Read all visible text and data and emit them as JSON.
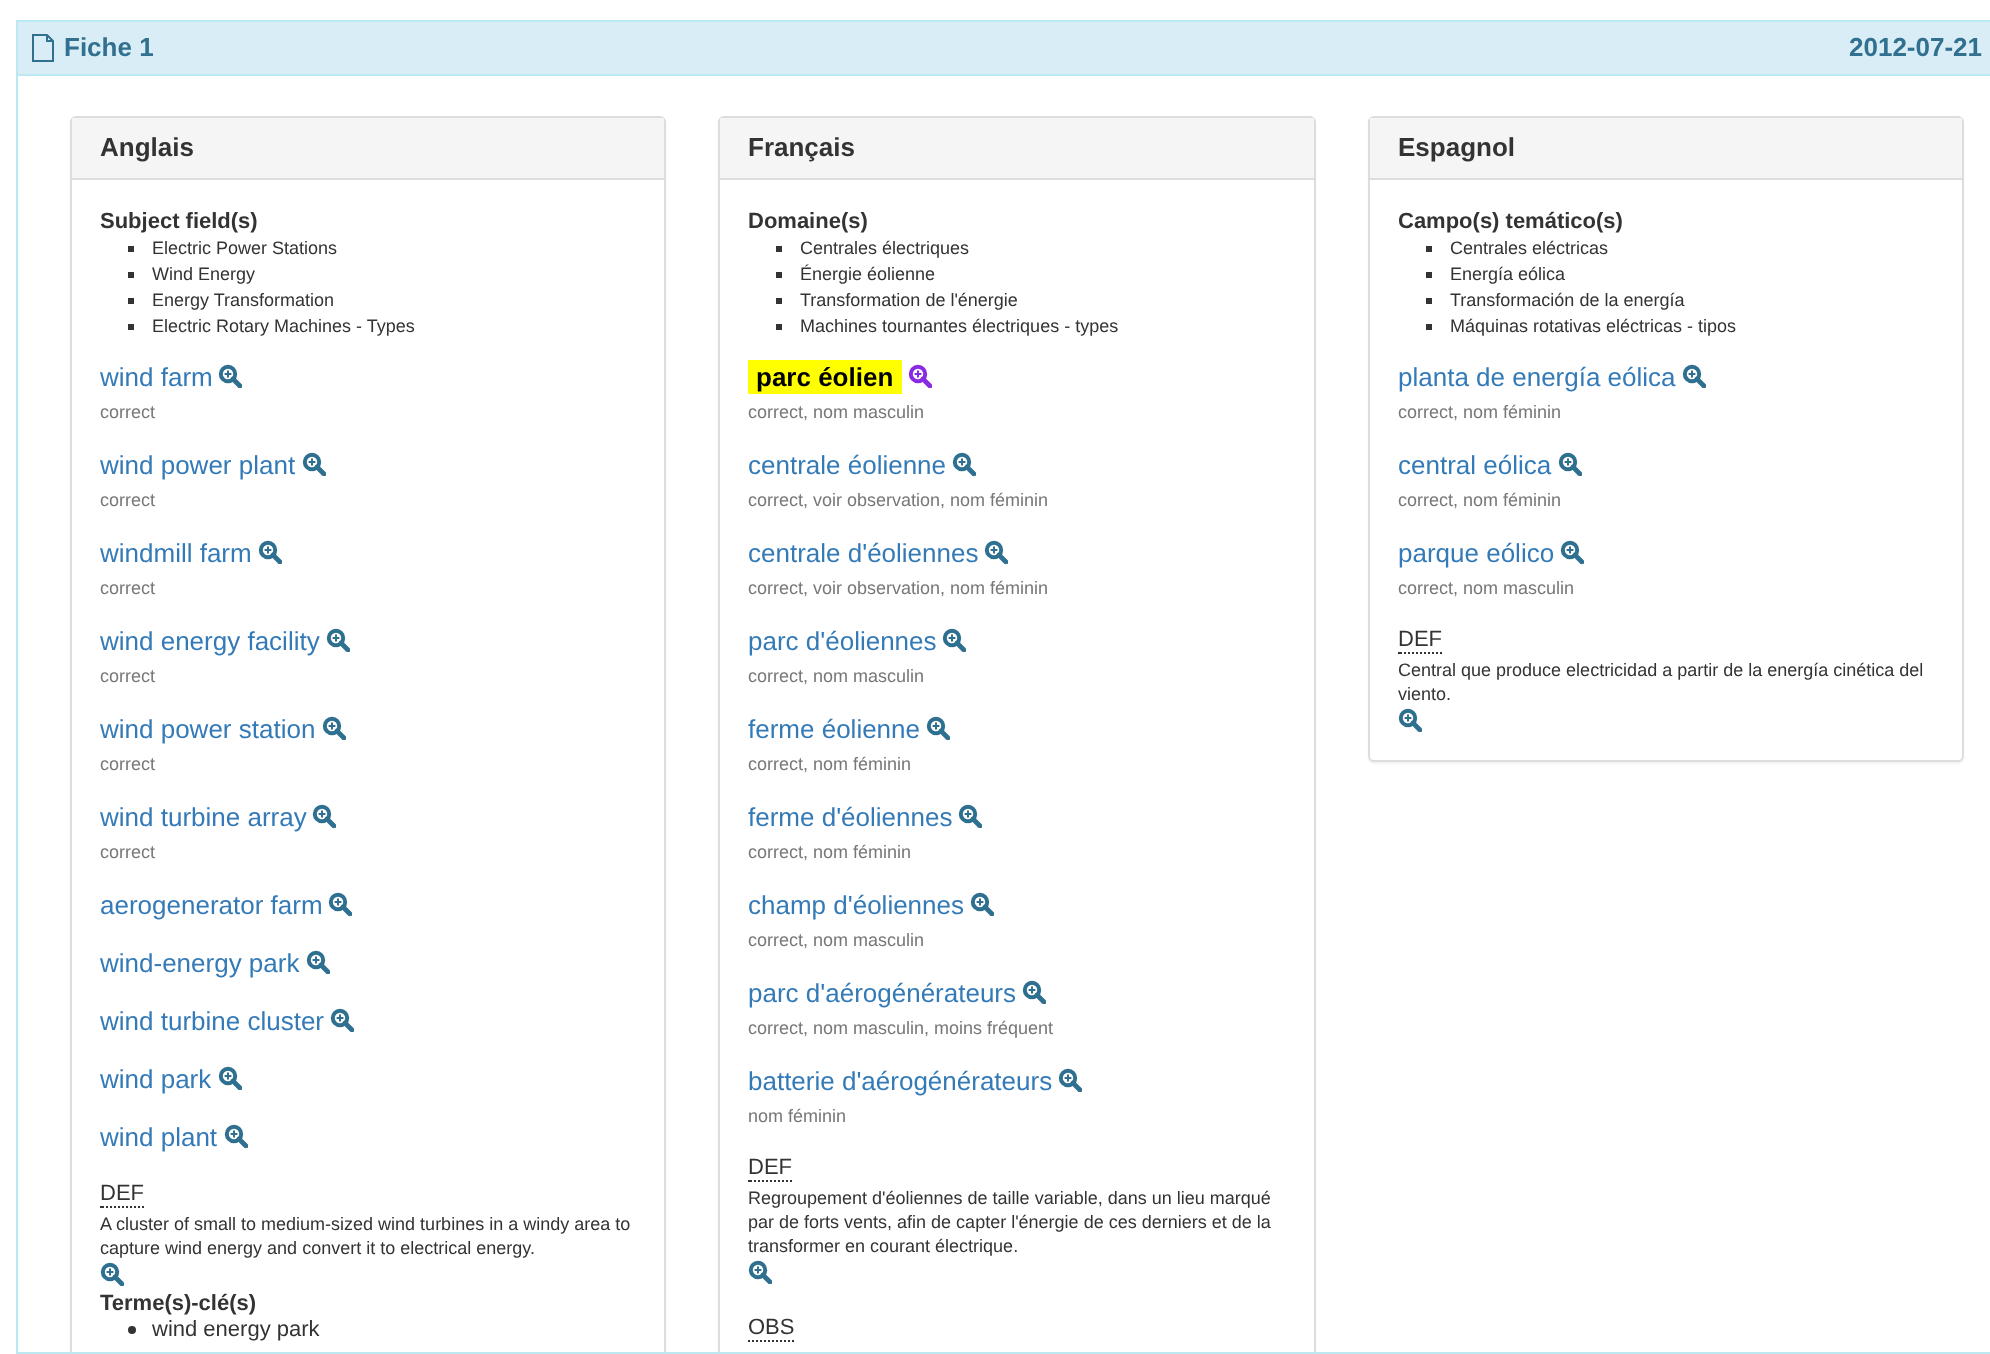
{
  "header": {
    "title": "Fiche 1",
    "date": "2012-07-21"
  },
  "columns": [
    {
      "language": "Anglais",
      "field_label": "Subject field(s)",
      "fields": [
        "Electric Power Stations",
        "Wind Energy",
        "Energy Transformation",
        "Electric Rotary Machines - Types"
      ],
      "terms": [
        {
          "text": "wind farm",
          "note": "correct",
          "selected": false
        },
        {
          "text": "wind power plant",
          "note": "correct",
          "selected": false
        },
        {
          "text": "windmill farm",
          "note": "correct",
          "selected": false
        },
        {
          "text": "wind energy facility",
          "note": "correct",
          "selected": false
        },
        {
          "text": "wind power station",
          "note": "correct",
          "selected": false
        },
        {
          "text": "wind turbine array",
          "note": "correct",
          "selected": false
        },
        {
          "text": "aerogenerator farm",
          "selected": false
        },
        {
          "text": "wind-energy park",
          "selected": false
        },
        {
          "text": "wind turbine cluster",
          "selected": false
        },
        {
          "text": "wind park",
          "selected": false
        },
        {
          "text": "wind plant",
          "selected": false
        }
      ],
      "sections": [
        {
          "kind": "definition",
          "label": "DEF",
          "text": "A cluster of small to medium-sized wind turbines in a windy area to capture wind energy and convert it to electrical energy."
        },
        {
          "kind": "keyterms",
          "label": "Terme(s)-clé(s)",
          "items": [
            "wind energy park"
          ]
        }
      ]
    },
    {
      "language": "Français",
      "field_label": "Domaine(s)",
      "fields": [
        "Centrales électriques",
        "Énergie éolienne",
        "Transformation de l'énergie",
        "Machines tournantes électriques - types"
      ],
      "terms": [
        {
          "text": "parc éolien",
          "note": "correct, nom masculin",
          "selected": true
        },
        {
          "text": "centrale éolienne",
          "note": "correct, voir observation, nom féminin",
          "selected": false
        },
        {
          "text": "centrale d'éoliennes",
          "note": "correct, voir observation, nom féminin",
          "selected": false
        },
        {
          "text": "parc d'éoliennes",
          "note": "correct, nom masculin",
          "selected": false
        },
        {
          "text": "ferme éolienne",
          "note": "correct, nom féminin",
          "selected": false
        },
        {
          "text": "ferme d'éoliennes",
          "note": "correct, nom féminin",
          "selected": false
        },
        {
          "text": "champ d'éoliennes",
          "note": "correct, nom masculin",
          "selected": false
        },
        {
          "text": "parc d'aérogénérateurs",
          "note": "correct, nom masculin, moins fréquent",
          "selected": false
        },
        {
          "text": "batterie d'aérogénérateurs",
          "note": "nom féminin",
          "selected": false
        }
      ],
      "sections": [
        {
          "kind": "definition",
          "label": "DEF",
          "text": "Regroupement d'éoliennes de taille variable, dans un lieu marqué par de forts vents, afin de capter l'énergie de ces derniers et de la transformer en courant électrique."
        },
        {
          "kind": "observation",
          "label": "OBS"
        }
      ]
    },
    {
      "language": "Espagnol",
      "field_label": "Campo(s) temático(s)",
      "fields": [
        "Centrales eléctricas",
        "Energía eólica",
        "Transformación de la energía",
        "Máquinas rotativas eléctricas - tipos"
      ],
      "terms": [
        {
          "text": "planta de energía eólica",
          "note": "correct, nom féminin",
          "selected": false
        },
        {
          "text": "central eólica",
          "note": "correct, nom féminin",
          "selected": false
        },
        {
          "text": "parque eólico",
          "note": "correct, nom masculin",
          "selected": false
        }
      ],
      "sections": [
        {
          "kind": "definition",
          "label": "DEF",
          "text": "Central que produce electricidad a partir de la energía cinética del viento."
        }
      ]
    }
  ]
}
